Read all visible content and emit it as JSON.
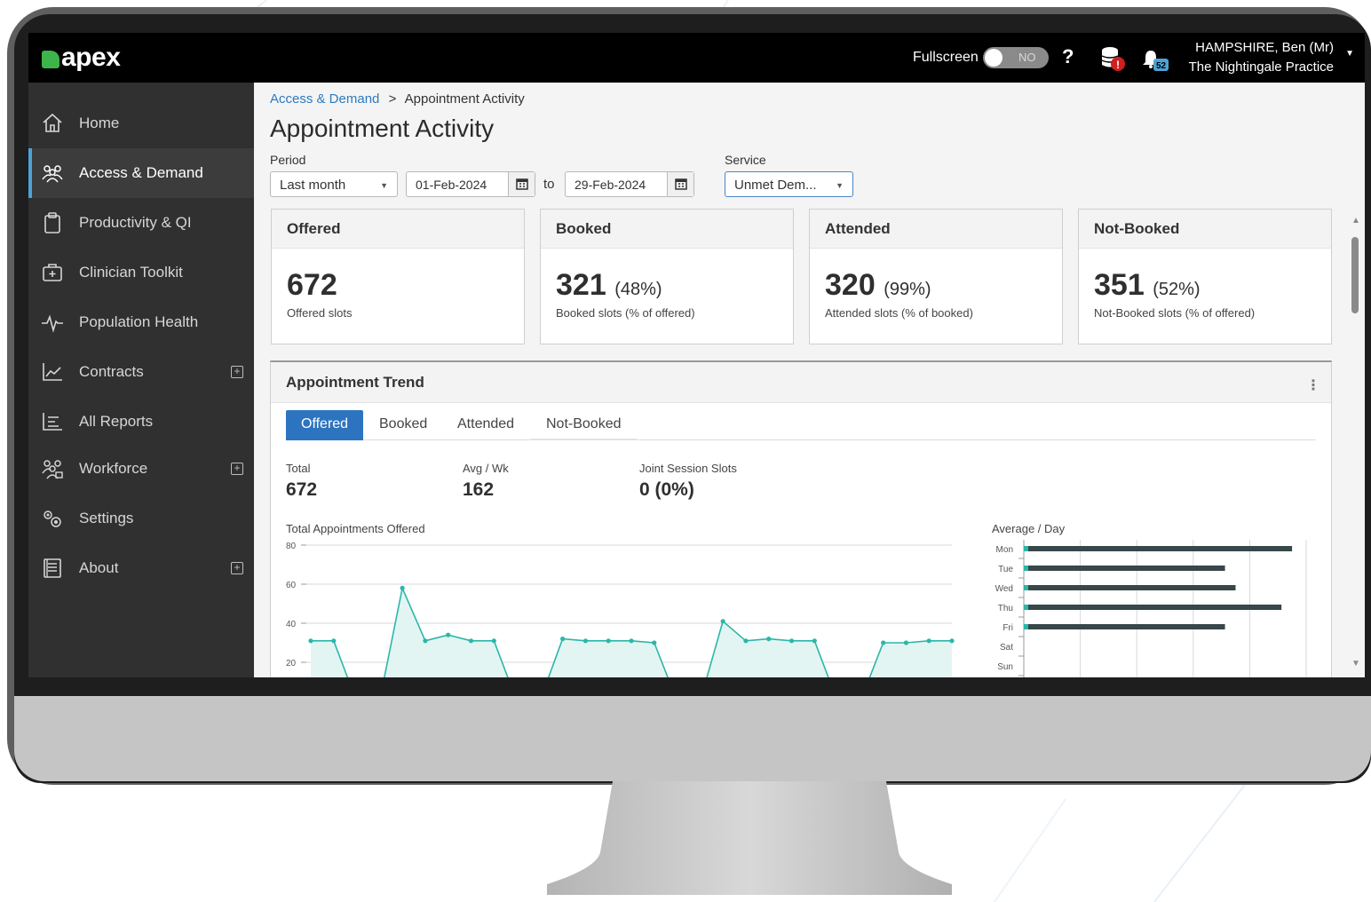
{
  "topbar": {
    "logo_text": "apex",
    "fullscreen_label": "Fullscreen",
    "toggle_state": "NO",
    "help_label": "?",
    "db_badge": "!",
    "bell_badge": "52",
    "user_name": "HAMPSHIRE, Ben (Mr)",
    "practice": "The Nightingale Practice"
  },
  "sidebar": {
    "items": [
      {
        "label": "Home",
        "icon": "home-icon"
      },
      {
        "label": "Access & Demand",
        "icon": "users-icon"
      },
      {
        "label": "Productivity & QI",
        "icon": "clipboard-icon"
      },
      {
        "label": "Clinician Toolkit",
        "icon": "medical-bag-icon"
      },
      {
        "label": "Population Health",
        "icon": "pulse-icon"
      },
      {
        "label": "Contracts",
        "icon": "line-chart-icon"
      },
      {
        "label": "All Reports",
        "icon": "list-icon"
      },
      {
        "label": "Workforce",
        "icon": "team-icon"
      },
      {
        "label": "Settings",
        "icon": "gears-icon"
      },
      {
        "label": "About",
        "icon": "book-icon"
      }
    ]
  },
  "breadcrumb": {
    "parent": "Access & Demand",
    "separator": ">",
    "current": "Appointment Activity"
  },
  "page_title": "Appointment Activity",
  "filters": {
    "period_label": "Period",
    "period_value": "Last month",
    "date_from": "01-Feb-2024",
    "to_label": "to",
    "date_to": "29-Feb-2024",
    "service_label": "Service",
    "service_value": "Unmet Dem..."
  },
  "kpis": [
    {
      "title": "Offered",
      "value": "672",
      "pct": "",
      "sub": "Offered slots"
    },
    {
      "title": "Booked",
      "value": "321",
      "pct": "(48%)",
      "sub": "Booked slots (% of offered)"
    },
    {
      "title": "Attended",
      "value": "320",
      "pct": "(99%)",
      "sub": "Attended slots (% of booked)"
    },
    {
      "title": "Not-Booked",
      "value": "351",
      "pct": "(52%)",
      "sub": "Not-Booked slots (% of offered)"
    }
  ],
  "trend": {
    "title": "Appointment Trend",
    "tabs": [
      "Offered",
      "Booked",
      "Attended",
      "Not-Booked"
    ],
    "stats": [
      {
        "label": "Total",
        "value": "672"
      },
      {
        "label": "Avg / Wk",
        "value": "162"
      },
      {
        "label": "Joint Session Slots",
        "value": "0 (0%)"
      }
    ],
    "chart_title": "Total Appointments Offered",
    "avg_title": "Average / Day"
  },
  "chart_data": [
    {
      "type": "area",
      "title": "Total Appointments Offered",
      "ylim": [
        0,
        80
      ],
      "y_ticks": [
        "80",
        "60",
        "40",
        "20"
      ],
      "x": [
        1,
        2,
        3,
        4,
        5,
        6,
        7,
        8,
        9,
        10,
        11,
        12,
        13,
        14,
        15,
        16,
        17,
        18,
        19,
        20,
        21,
        22,
        23,
        24,
        25,
        26,
        27,
        28,
        29
      ],
      "values": [
        31,
        31,
        0,
        0,
        58,
        31,
        34,
        31,
        31,
        0,
        0,
        32,
        31,
        31,
        31,
        30,
        0,
        0,
        41,
        31,
        32,
        31,
        31,
        0,
        0,
        30,
        30,
        31,
        31
      ]
    },
    {
      "type": "bar",
      "title": "Average / Day",
      "categories": [
        "Mon",
        "Tue",
        "Wed",
        "Thu",
        "Fri",
        "Sat",
        "Sun"
      ],
      "values": [
        38,
        28.5,
        30,
        36.5,
        28.5,
        0,
        0
      ]
    }
  ],
  "colors": {
    "accent": "#2d74c0",
    "brand": "#3db54a",
    "series": "#2ab7a9",
    "bar": "#37474a"
  }
}
